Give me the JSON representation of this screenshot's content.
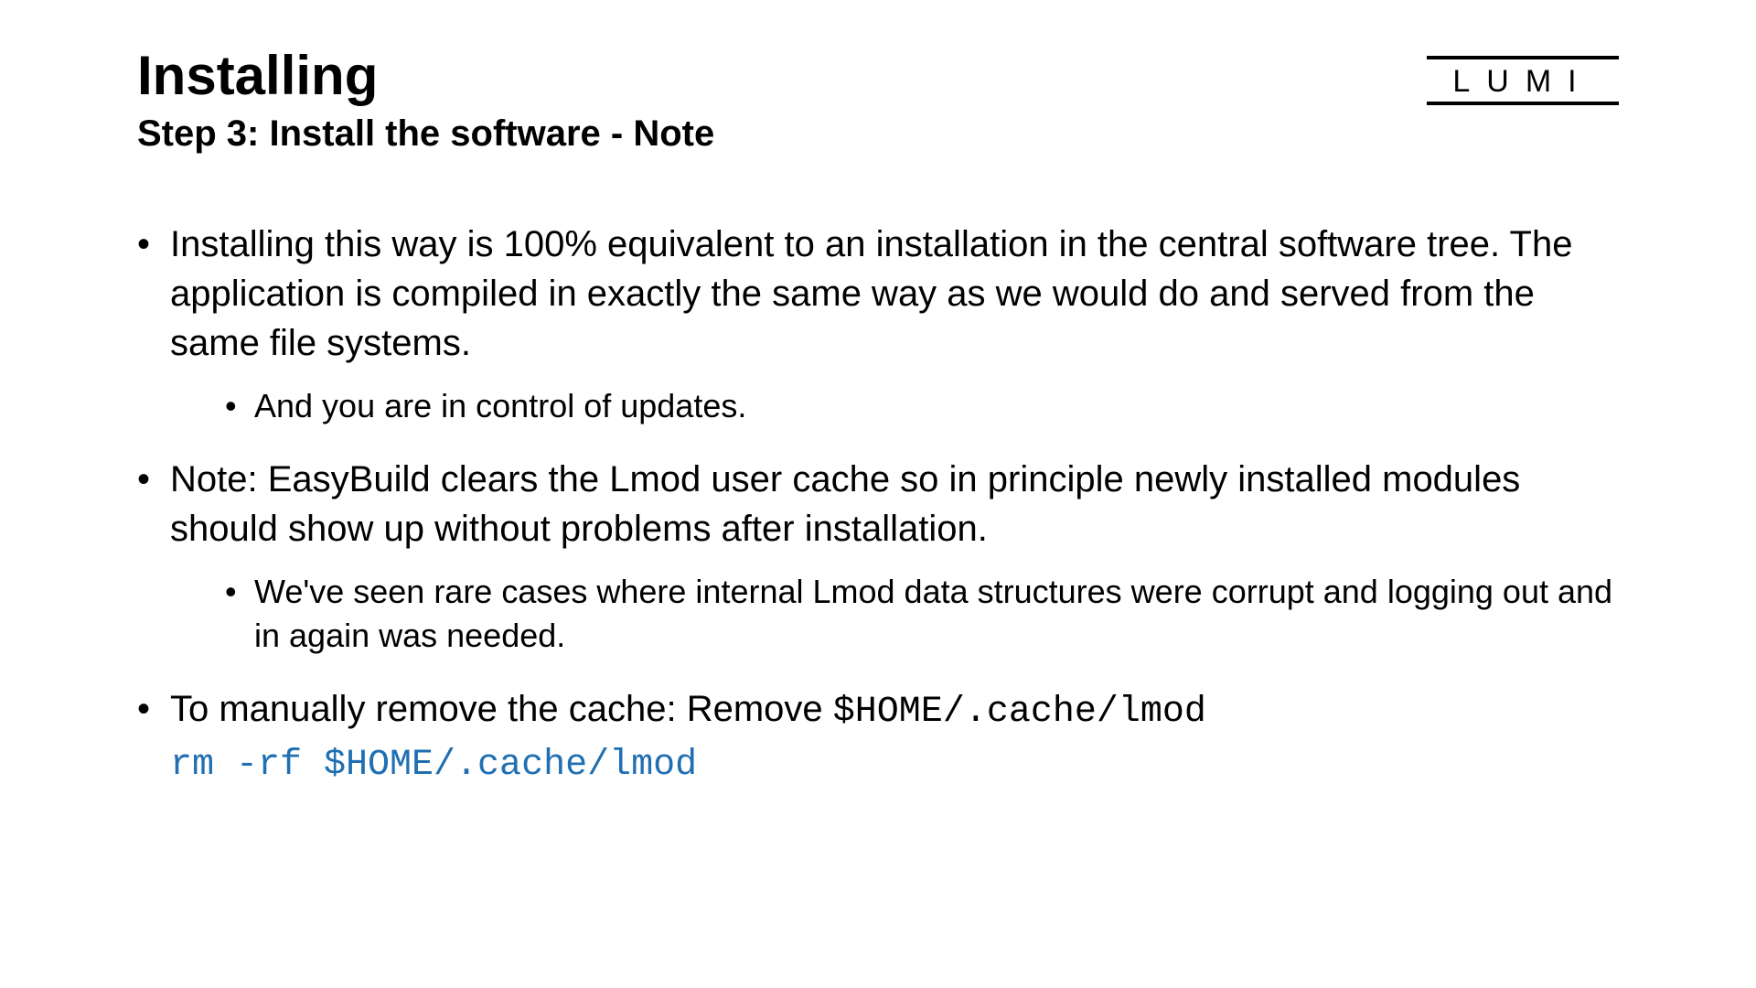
{
  "header": {
    "title": "Installing",
    "subtitle": "Step 3: Install the software - Note",
    "logo_text": "LUMI"
  },
  "bullets": [
    {
      "text": "Installing this way is 100% equivalent to an installation in the central software tree. The application is compiled in exactly the same way as we would do and served from the same file systems.",
      "sub": [
        "And you are in control of updates."
      ]
    },
    {
      "text": "Note: EasyBuild clears the Lmod user cache so in principle newly installed modules should show up without problems after installation.",
      "sub": [
        "We've seen rare cases where internal Lmod data structures were corrupt and logging out and in again was needed."
      ]
    },
    {
      "text_prefix": "To manually remove the cache: Remove ",
      "text_mono": "$HOME/.cache/lmod",
      "command": "rm -rf $HOME/.cache/lmod"
    }
  ]
}
